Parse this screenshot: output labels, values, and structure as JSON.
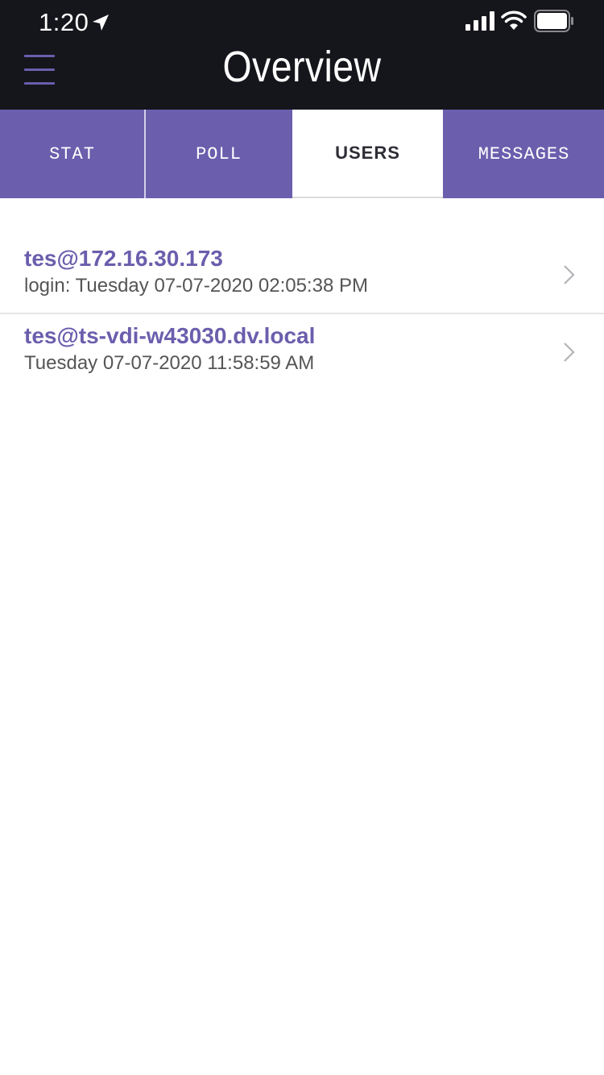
{
  "status_bar": {
    "time": "1:20",
    "icons": [
      "location-arrow-icon",
      "cellular-signal-icon",
      "wifi-icon",
      "battery-icon"
    ]
  },
  "header": {
    "title": "Overview",
    "menu_icon": "hamburger-menu-icon"
  },
  "tabs": [
    {
      "label": "STAT",
      "active": false
    },
    {
      "label": "POLL",
      "active": false
    },
    {
      "label": "USERS",
      "active": true
    },
    {
      "label": "MESSAGES",
      "active": false
    }
  ],
  "users": [
    {
      "name": "tes@172.16.30.173",
      "detail": "login: Tuesday 07-07-2020 02:05:38 PM"
    },
    {
      "name": "tes@ts-vdi-w43030.dv.local",
      "detail": "Tuesday 07-07-2020 11:58:59 AM"
    }
  ],
  "colors": {
    "header_bg": "#15151c",
    "accent": "#6b5ead",
    "active_tab_bg": "#ffffff",
    "subtext": "#555555"
  }
}
